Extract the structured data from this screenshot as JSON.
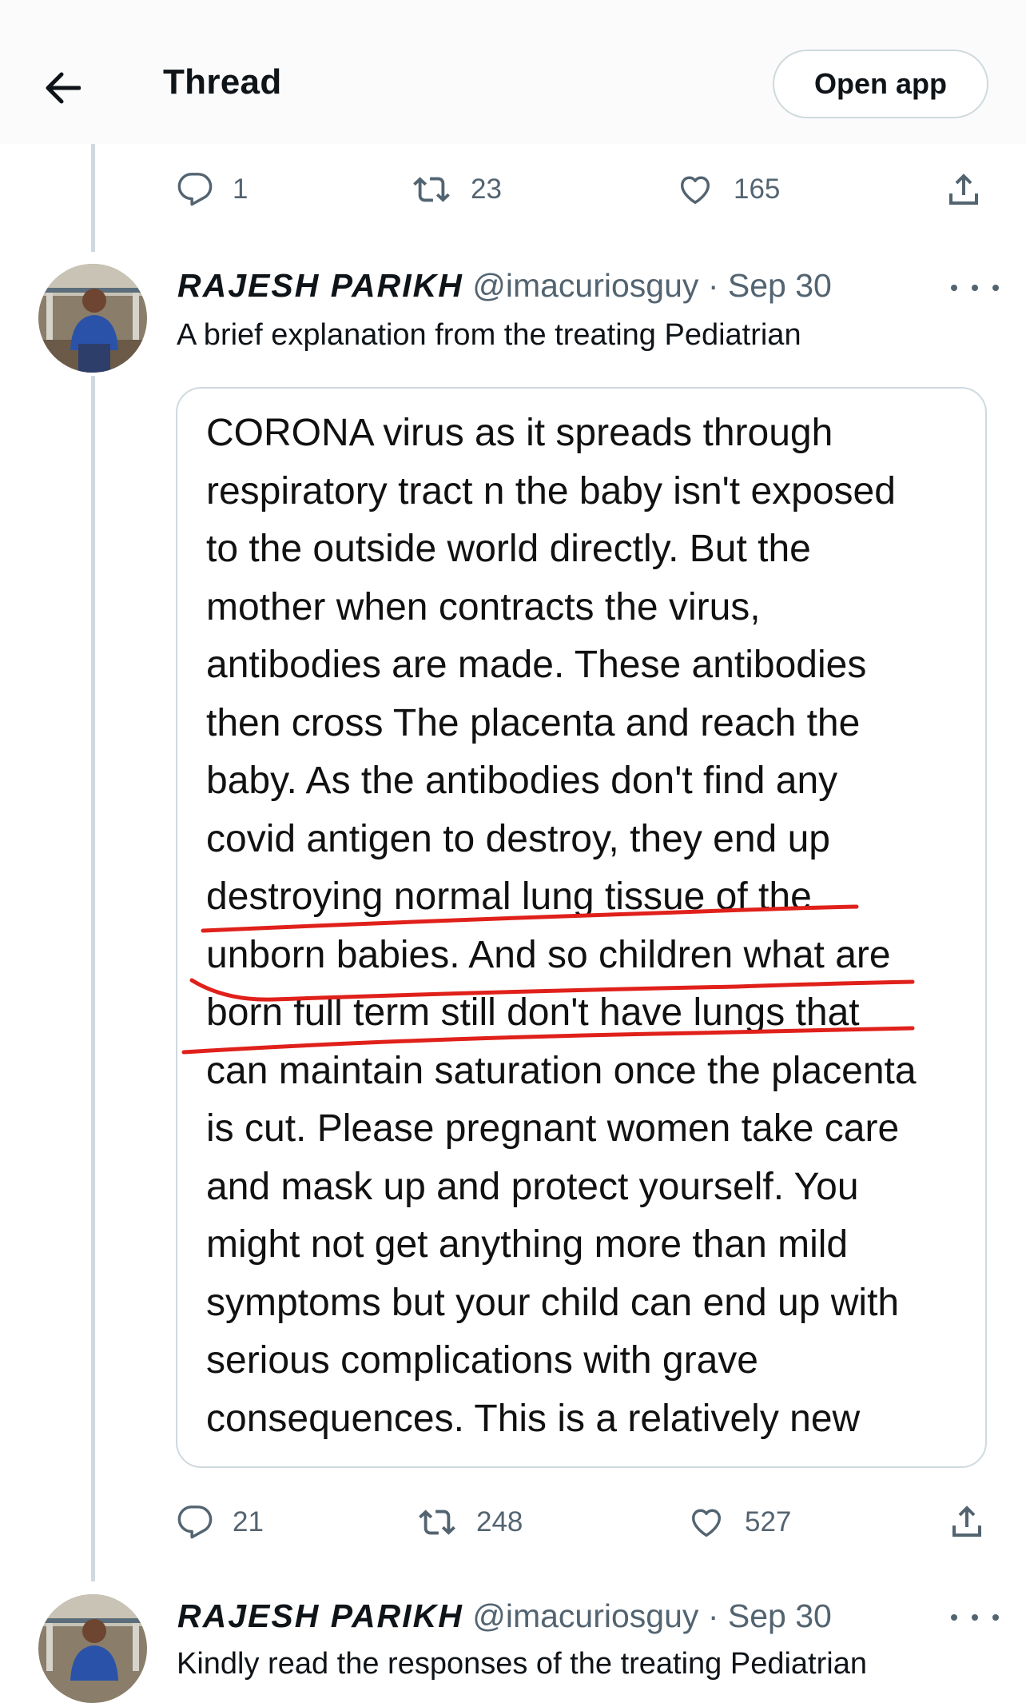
{
  "header": {
    "title": "Thread",
    "open_app_label": "Open app"
  },
  "first_tweet_actions": {
    "replies": "1",
    "retweets": "23",
    "likes": "165"
  },
  "tweets": [
    {
      "author": "RAJESH PARIKH",
      "handle": "@imacuriosguy",
      "separator": "·",
      "date": "Sep 30",
      "text": "A brief explanation from the treating Pediatrian",
      "image_text": [
        "CORONA virus as it spreads through",
        "respiratory tract n the baby isn't exposed",
        "to the outside world directly. But the",
        "mother when contracts the virus,",
        "antibodies are made. These antibodies",
        "then cross The placenta and reach the",
        "baby. As the antibodies don't find any",
        "covid antigen to destroy,  they end up",
        "destroying normal lung tissue of the",
        "unborn babies. And so children what are",
        "born full term still don't have lungs that",
        "can maintain saturation once the placenta",
        "is cut. Please pregnant women take care",
        "and mask up and protect yourself. You",
        "might not get anything more than mild",
        "symptoms but your child can end up with",
        "serious complications with grave",
        "consequences. This is a relatively new"
      ],
      "actions": {
        "replies": "21",
        "retweets": "248",
        "likes": "527"
      }
    },
    {
      "author": "RAJESH PARIKH",
      "handle": "@imacuriosguy",
      "separator": "·",
      "date": "Sep 30",
      "text": "Kindly read the responses of the treating Pediatrian"
    }
  ],
  "colors": {
    "underline": "#e0201a",
    "muted": "#536471",
    "border": "#cfd9de"
  },
  "icons": [
    "back-arrow-icon",
    "reply-icon",
    "retweet-icon",
    "like-icon",
    "share-icon",
    "more-icon"
  ]
}
